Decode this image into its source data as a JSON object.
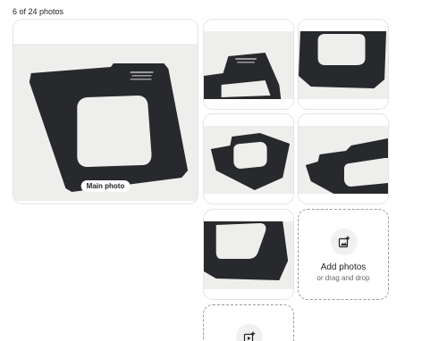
{
  "gallery": {
    "counter": "6 of 24 photos",
    "main_label": "Main photo",
    "tiles": [
      {
        "name": "photo-1",
        "view": "main"
      },
      {
        "name": "photo-2",
        "view": "corner-tab"
      },
      {
        "name": "photo-3",
        "view": "top-window"
      },
      {
        "name": "photo-4",
        "view": "tab-window"
      },
      {
        "name": "photo-5",
        "view": "side-tab"
      },
      {
        "name": "photo-6",
        "view": "bottom-window"
      }
    ]
  },
  "add_photos": {
    "title": "Add photos",
    "subtitle": "or drag and drop",
    "icon": "add-photo-icon"
  },
  "add_video": {
    "icon": "add-video-icon"
  },
  "colors": {
    "text": "#222222",
    "subtext": "#666666",
    "tile_border": "#e4e4e4",
    "dashed_border": "#9a9a9a",
    "photo_background": "#eeeeec",
    "part_color": "#27292c"
  }
}
